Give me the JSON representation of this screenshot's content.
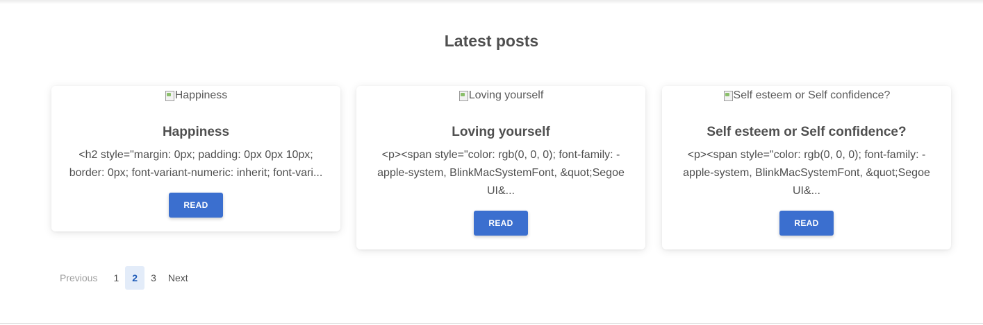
{
  "section": {
    "title": "Latest posts"
  },
  "posts": [
    {
      "image_alt": "Happiness",
      "title": "Happiness",
      "excerpt": "<h2 style=\"margin: 0px; padding: 0px 0px 10px; border: 0px; font-variant-numeric: inherit; font-vari...",
      "button_label": "READ"
    },
    {
      "image_alt": "Loving yourself",
      "title": "Loving yourself",
      "excerpt": "<p><span style=\"color: rgb(0, 0, 0); font-family: -apple-system, BlinkMacSystemFont, &quot;Segoe UI&...",
      "button_label": "READ"
    },
    {
      "image_alt": "Self esteem or Self confidence?",
      "title": "Self esteem or Self confidence?",
      "excerpt": "<p><span style=\"color: rgb(0, 0, 0); font-family: -apple-system, BlinkMacSystemFont, &quot;Segoe UI&...",
      "button_label": "READ"
    }
  ],
  "pagination": {
    "previous_label": "Previous",
    "pages": [
      "1",
      "2",
      "3"
    ],
    "current_page": "2",
    "next_label": "Next"
  },
  "colors": {
    "accent": "#3b6fcf",
    "active_page_bg": "#e3ecf9",
    "text": "#4f4f4f"
  }
}
